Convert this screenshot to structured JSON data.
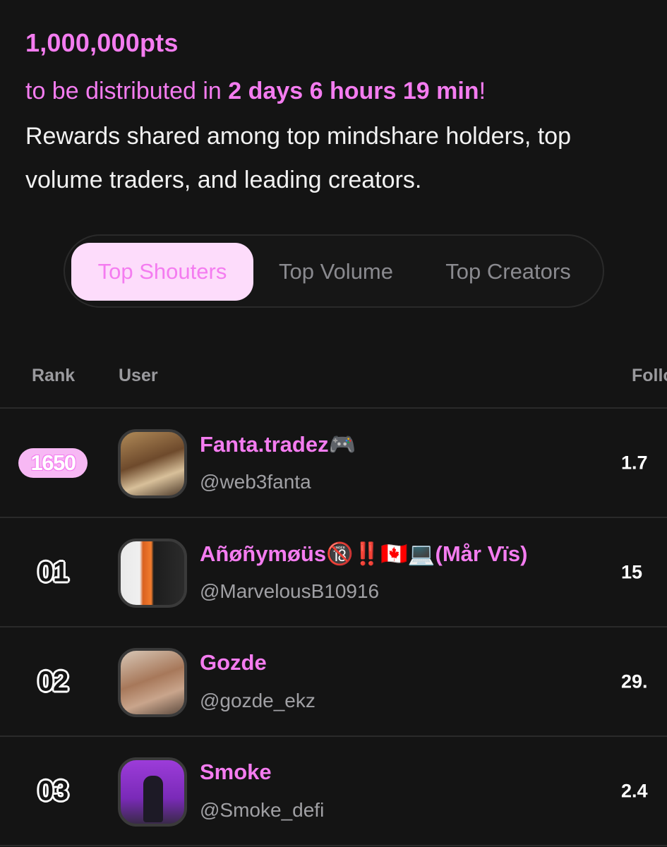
{
  "header": {
    "points": "1,000,000pts",
    "distributed_prefix": "to be distributed in ",
    "countdown": "2 days 6 hours 19 min",
    "distributed_suffix": "!",
    "rewards_text": "Rewards shared among top mindshare holders, top volume traders, and leading creators."
  },
  "tabs": [
    {
      "label": "Top Shouters",
      "active": true
    },
    {
      "label": "Top Volume",
      "active": false
    },
    {
      "label": "Top Creators",
      "active": false
    }
  ],
  "table": {
    "columns": [
      "Rank",
      "User",
      "Follo"
    ],
    "rows": [
      {
        "rank": "1650",
        "name": "Fanta.tradez🎮",
        "handle": "@web3fanta",
        "followers": "1.7"
      },
      {
        "rank": "01",
        "name": "Añøñymøüs🔞‼️🇨🇦💻(Mår Vïs)",
        "handle": "@MarvelousB10916",
        "followers": "15"
      },
      {
        "rank": "02",
        "name": "Gozde",
        "handle": "@gozde_ekz",
        "followers": "29."
      },
      {
        "rank": "03",
        "name": "Smoke",
        "handle": "@Smoke_defi",
        "followers": "2.4"
      }
    ]
  },
  "colors": {
    "accent": "#f47cf0",
    "active_tab_bg": "#fddcfb",
    "background": "#141414"
  }
}
